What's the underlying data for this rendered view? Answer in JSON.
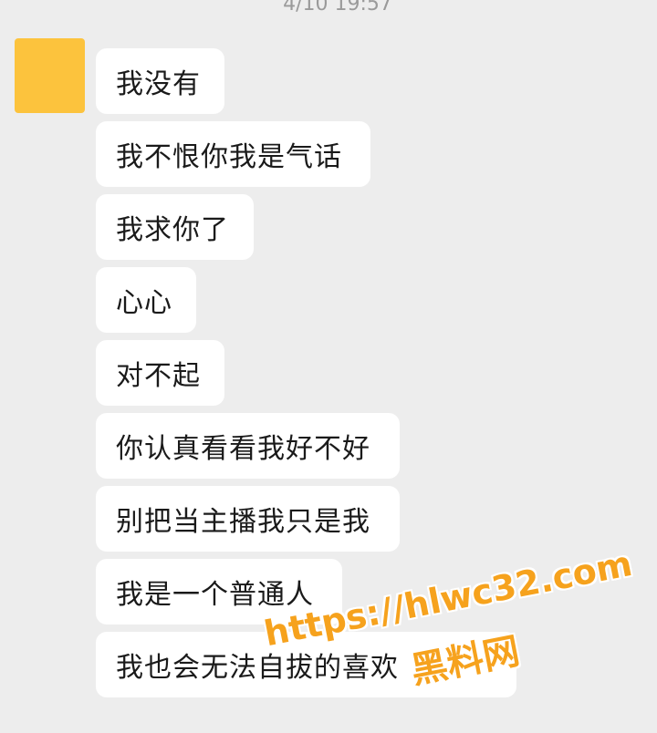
{
  "chat": {
    "timestamp": "4/10 19:57",
    "avatar_color": "#fcc33d",
    "messages": [
      {
        "text": "我没有"
      },
      {
        "text": "我不恨你我是气话"
      },
      {
        "text": "我求你了"
      },
      {
        "text": "心心"
      },
      {
        "text": "对不起"
      },
      {
        "text": "你认真看看我好不好"
      },
      {
        "text": "别把当主播我只是我"
      },
      {
        "text": "我是一个普通人"
      },
      {
        "text": "我也会无法自拔的喜欢"
      }
    ]
  },
  "watermark": {
    "url": "https://hlwc32.com",
    "name": "黑料网"
  }
}
